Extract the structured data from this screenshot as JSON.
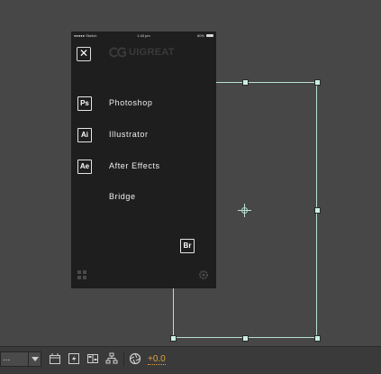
{
  "phone": {
    "status": {
      "carrier": "●●●●● Sketch",
      "time": "1:43 pm",
      "battery": "80%"
    },
    "close_glyph": "✕",
    "logo": "UIGREAT",
    "menu": [
      {
        "badge": "Ps",
        "label": "Photoshop"
      },
      {
        "badge": "Ai",
        "label": "Illustrator"
      },
      {
        "badge": "Ae",
        "label": "After Effects"
      },
      {
        "badge": "",
        "label": "Bridge"
      }
    ],
    "bridge_badge": "Br"
  },
  "toolbar": {
    "dropdown_value": "...",
    "exposure_value": "+0.0"
  },
  "colors": {
    "canvas": "#474747",
    "phone_bg": "#1e1e1e",
    "bbox": "#b8e0d2",
    "exposure": "#e3a23a"
  },
  "icons": [
    "close-icon",
    "logo-mark-icon",
    "grid-icon",
    "gear-icon",
    "pivot-crosshair-icon",
    "region-icon",
    "fast-preview-icon",
    "transparency-grid-icon",
    "flowchart-icon",
    "exposure-shutter-icon",
    "dropdown-arrow-icon"
  ]
}
